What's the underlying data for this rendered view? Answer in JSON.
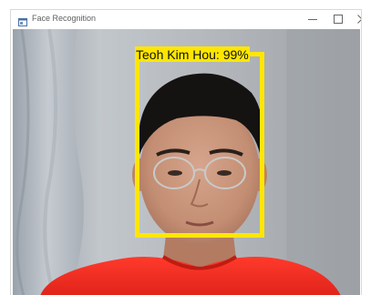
{
  "window": {
    "title": "Face Recognition",
    "icons": {
      "app": "app-window-icon",
      "minimize": "minimize-icon",
      "maximize": "maximize-icon",
      "close": "close-icon"
    }
  },
  "video": {
    "detection": {
      "label": "Teoh Kim Hou: 99%",
      "confidence": 0.99,
      "box_color": "#ffe600"
    }
  }
}
